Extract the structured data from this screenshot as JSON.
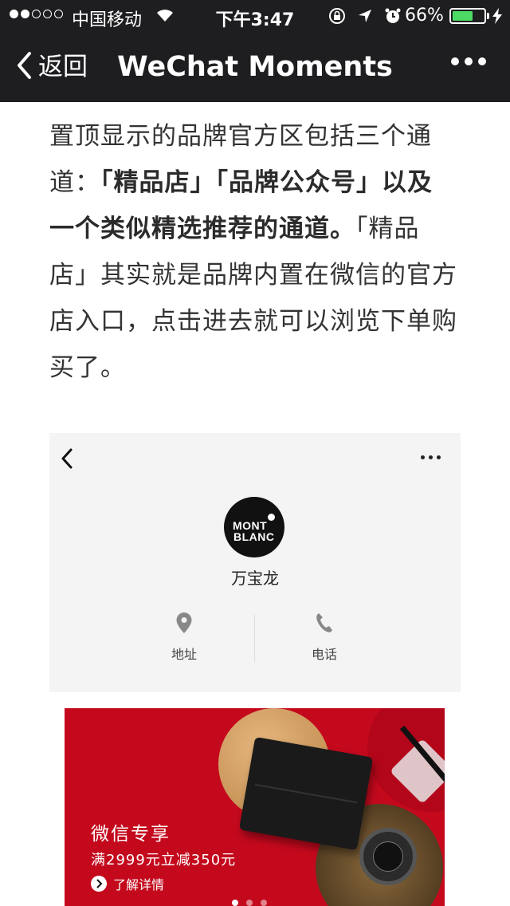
{
  "status": {
    "carrier": "中国移动",
    "time": "下午3:47",
    "battery": "66%",
    "battery_level": 0.66
  },
  "nav": {
    "back_label": "返回",
    "title": "WeChat Moments"
  },
  "article": {
    "line1": "置顶显示的品牌官方区包括三个通",
    "line2_pre": "道：",
    "line2_bold": "「精品店」「品牌公众号」以及",
    "line3_bold": "一个类似精选推荐的通道。",
    "line3_post": "「精品",
    "line4": "店」其实就是品牌内置在微信的官方",
    "line5": "店入口，点击进去就可以浏览下单购",
    "line6": "买了。"
  },
  "brand_card": {
    "logo_line1": "MONT",
    "logo_line2": "BLANC",
    "name": "万宝龙",
    "actions": [
      {
        "label": "地址",
        "icon": "location-pin-icon"
      },
      {
        "label": "电话",
        "icon": "phone-icon"
      }
    ]
  },
  "banner": {
    "title": "微信专享",
    "promo": "满2999元立减350元",
    "cta": "了解详情",
    "colors": {
      "background": "#c4091d"
    }
  }
}
